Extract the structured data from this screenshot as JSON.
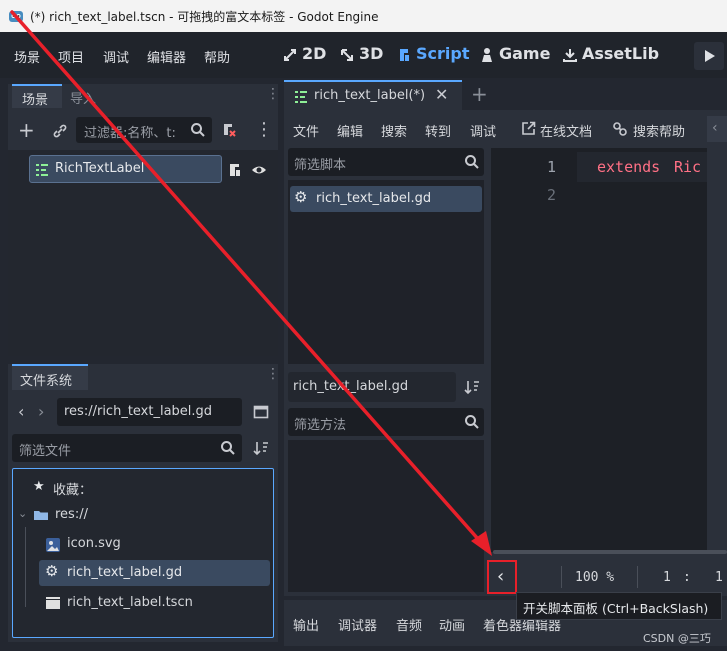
{
  "window": {
    "title": "(*) rich_text_label.tscn - 可拖拽的富文本标签 - Godot Engine"
  },
  "menu": {
    "items": [
      "场景",
      "项目",
      "调试",
      "编辑器",
      "帮助"
    ]
  },
  "workspaces": [
    {
      "label": "2D",
      "icon": "2d-icon"
    },
    {
      "label": "3D",
      "icon": "3d-icon"
    },
    {
      "label": "Script",
      "icon": "script-icon",
      "active": true
    },
    {
      "label": "Game",
      "icon": "game-icon"
    },
    {
      "label": "AssetLib",
      "icon": "assetlib-icon"
    }
  ],
  "scene_dock": {
    "tabs": [
      "场景",
      "导入"
    ],
    "filter_placeholder": "过滤器:名称、t:",
    "node": "RichTextLabel"
  },
  "filesystem_dock": {
    "title": "文件系统",
    "path": "res://rich_text_label.gd",
    "filter_placeholder": "筛选文件",
    "favorites_label": "收藏：",
    "items": [
      {
        "label": "res://",
        "icon": "folder-icon"
      },
      {
        "label": "icon.svg",
        "icon": "image-file-icon"
      },
      {
        "label": "rich_text_label.gd",
        "icon": "gear-icon"
      },
      {
        "label": "rich_text_label.tscn",
        "icon": "scene-file-icon"
      }
    ]
  },
  "script_editor": {
    "tab_label": "rich_text_label(*)",
    "menu": [
      "文件",
      "编辑",
      "搜索",
      "转到",
      "调试"
    ],
    "online_docs": "在线文档",
    "search_help": "搜索帮助",
    "filter_scripts_placeholder": "筛选脚本",
    "script_list": [
      "rich_text_label.gd"
    ],
    "current_script": "rich_text_label.gd",
    "filter_methods_placeholder": "筛选方法",
    "line_numbers": [
      "1",
      "2"
    ],
    "code_keyword": "extends",
    "code_rest": "Ric",
    "zoom": "100 %",
    "cursor_line": "1",
    "cursor_col": "1",
    "tooltip": "开关脚本面板 (Ctrl+BackSlash)"
  },
  "bottom_panel": {
    "tabs": [
      "输出",
      "调试器",
      "音频",
      "动画",
      "着色器编辑器"
    ]
  },
  "watermark": "CSDN @三巧",
  "colors": {
    "accent": "#5aa8ff",
    "keyword": "#ff7085",
    "annotation": "#e8202a"
  }
}
